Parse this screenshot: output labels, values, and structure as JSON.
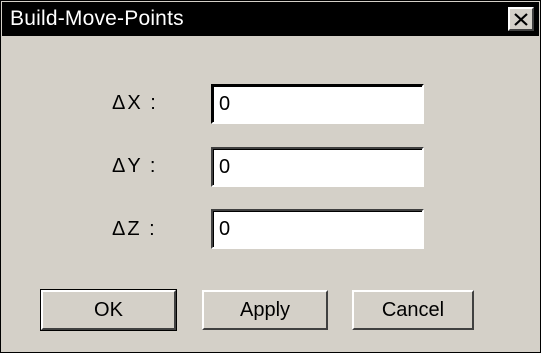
{
  "window": {
    "title": "Build-Move-Points",
    "close_icon": "close-icon"
  },
  "fields": [
    {
      "label": "ΔX :",
      "value": "0"
    },
    {
      "label": "ΔY :",
      "value": "0"
    },
    {
      "label": "ΔZ :",
      "value": "0"
    }
  ],
  "buttons": {
    "ok": "OK",
    "apply": "Apply",
    "cancel": "Cancel"
  },
  "colors": {
    "title_bar": "#000000",
    "dialog_face": "#d4d0c8",
    "input_bg": "#ffffff"
  }
}
